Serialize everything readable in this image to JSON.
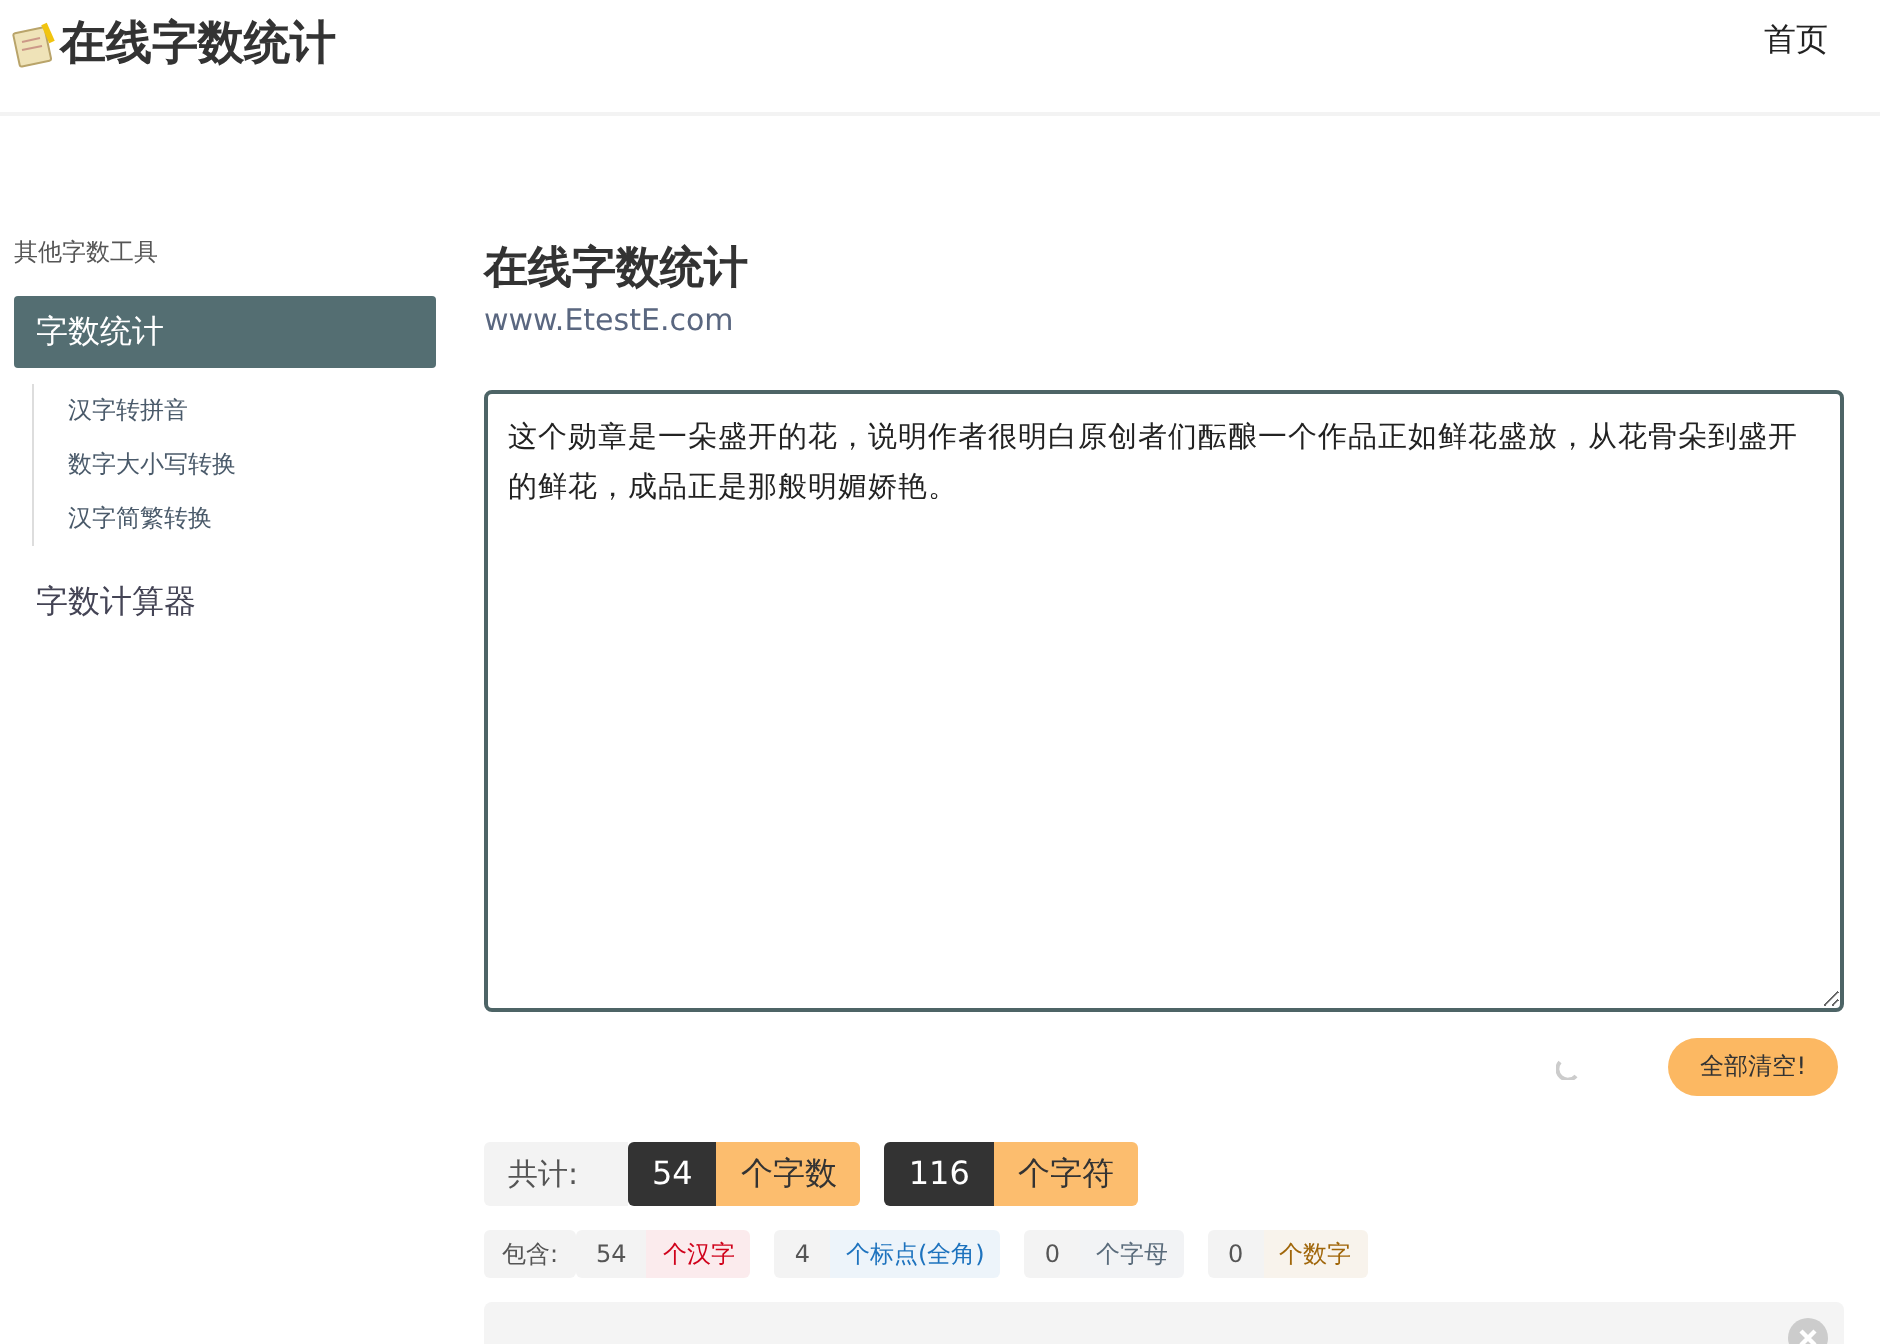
{
  "header": {
    "logo_text": "在线字数统计",
    "nav": [
      {
        "label": "首页"
      }
    ]
  },
  "sidebar": {
    "heading": "其他字数工具",
    "items": [
      {
        "label": "字数统计",
        "selected": true,
        "children": [
          {
            "label": "汉字转拼音"
          },
          {
            "label": "数字大小写转换"
          },
          {
            "label": "汉字简繁转换"
          }
        ]
      },
      {
        "label": "字数计算器",
        "selected": false
      }
    ]
  },
  "main": {
    "title": "在线字数统计",
    "subtitle": "www.EtestE.com",
    "editor": {
      "value": "这个勋章是一朵盛开的花，说明作者很明白原创者们酝酿一个作品正如鲜花盛放，从花骨朵到盛开的鲜花，成品正是那般明媚娇艳。"
    },
    "clear_button": "全部清空!",
    "totals": {
      "label": "共计:",
      "items": [
        {
          "count": "54",
          "unit": "个字数"
        },
        {
          "count": "116",
          "unit": "个字符"
        }
      ]
    },
    "details": {
      "label": "包含:",
      "items": [
        {
          "count": "54",
          "unit": "个汉字",
          "color": "#d0021b"
        },
        {
          "count": "4",
          "unit": "个标点(全角)",
          "color": "#1e73be"
        },
        {
          "count": "0",
          "unit": "个字母",
          "color": "#5a6b7b"
        },
        {
          "count": "0",
          "unit": "个数字",
          "color": "#a0660a"
        }
      ]
    }
  }
}
